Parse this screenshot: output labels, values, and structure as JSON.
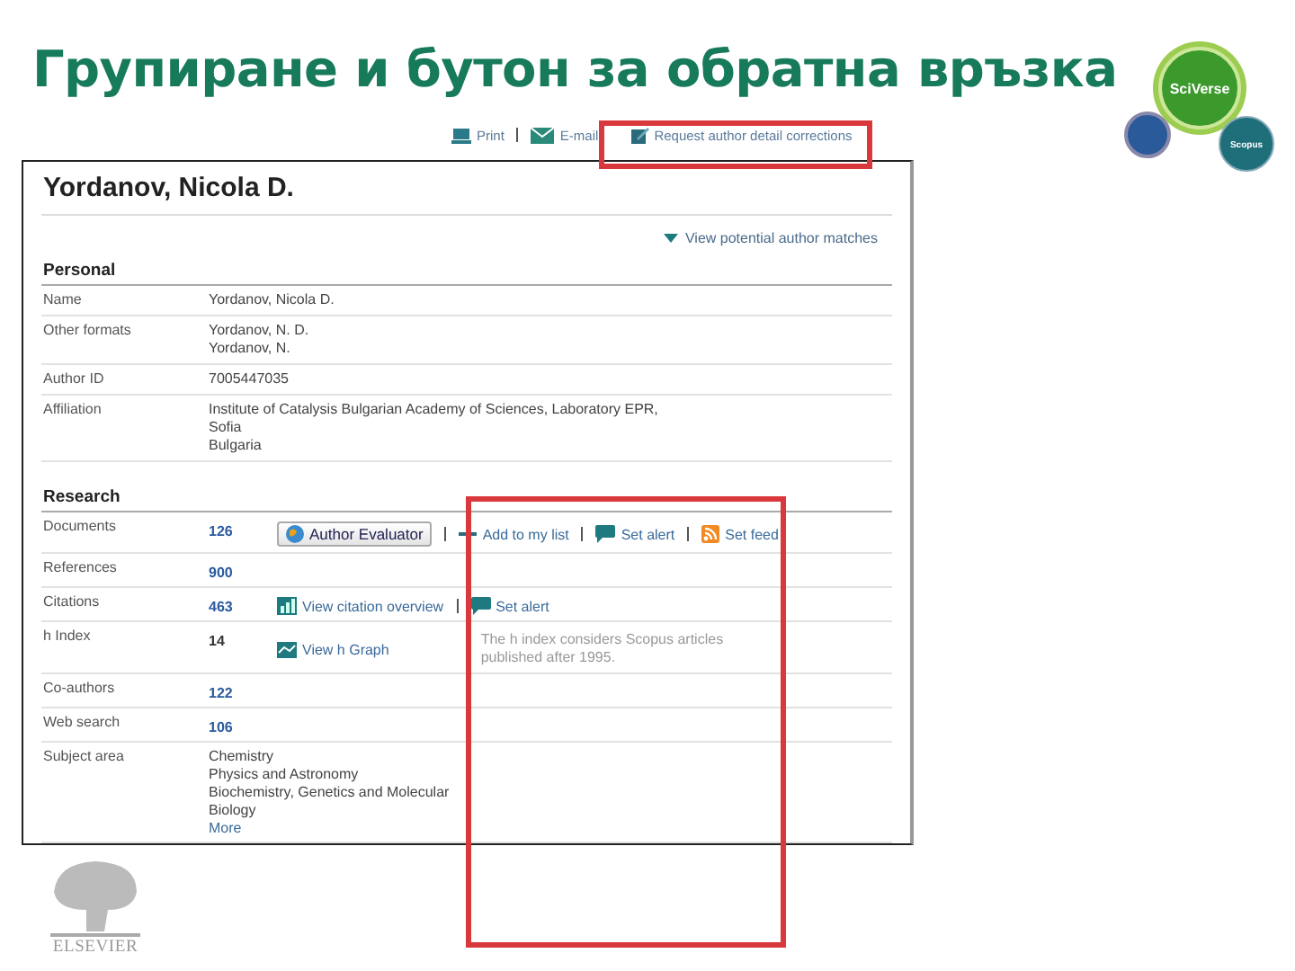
{
  "title": "Групиране и бутон за обратна връзка",
  "badges": [
    {
      "kind": "large",
      "label": "SciVerse"
    },
    {
      "kind": "small",
      "label": "Scopus"
    }
  ],
  "toolbar": [
    {
      "kind": "print",
      "label": "Print"
    },
    {
      "kind": "email",
      "label": "E-mail"
    },
    {
      "kind": "edit",
      "label": "Request author detail corrections"
    }
  ],
  "author": {
    "name": "Yordanov, Nicola D.",
    "matches_link": "View potential author matches",
    "sections": [
      {
        "heading": "Personal",
        "rows": [
          {
            "label": "Name",
            "kind": "text",
            "values": [
              "Yordanov, Nicola D."
            ]
          },
          {
            "label": "Other formats",
            "kind": "text",
            "values": [
              "Yordanov, N. D.",
              "Yordanov, N."
            ]
          },
          {
            "label": "Author ID",
            "kind": "text",
            "values": [
              "7005447035"
            ]
          },
          {
            "label": "Affiliation",
            "kind": "text",
            "values": [
              "Institute of Catalysis Bulgarian Academy of Sciences, Laboratory EPR,",
              "Sofia",
              "Bulgaria"
            ]
          }
        ]
      },
      {
        "heading": "Research",
        "rows": [
          {
            "label": "Documents",
            "kind": "count_link",
            "values": [
              "126"
            ],
            "actions": [
              {
                "kind": "evaluator",
                "label": "Author Evaluator"
              },
              {
                "kind": "list",
                "label": "Add to my list"
              },
              {
                "kind": "alert",
                "label": "Set alert"
              },
              {
                "kind": "feed",
                "label": "Set feed"
              }
            ]
          },
          {
            "label": "References",
            "kind": "count_link",
            "values": [
              "900"
            ]
          },
          {
            "label": "Citations",
            "kind": "count_link",
            "values": [
              "463"
            ],
            "actions": [
              {
                "kind": "overview",
                "label": "View citation overview"
              },
              {
                "kind": "alert",
                "label": "Set alert"
              }
            ]
          },
          {
            "label": "h Index",
            "kind": "count",
            "values": [
              "14"
            ],
            "actions": [
              {
                "kind": "graph",
                "label": "View h Graph"
              }
            ],
            "note": "The h index considers Scopus articles published after 1995."
          },
          {
            "label": "Co-authors",
            "kind": "count_link",
            "values": [
              "122"
            ]
          },
          {
            "label": "Web search",
            "kind": "count_link",
            "values": [
              "106"
            ]
          },
          {
            "label": "Subject area",
            "kind": "text",
            "values": [
              "Chemistry",
              "Physics and Astronomy",
              "Biochemistry, Genetics and Molecular Biology"
            ],
            "more": "More"
          }
        ]
      }
    ]
  },
  "publisher": "ELSEVIER"
}
